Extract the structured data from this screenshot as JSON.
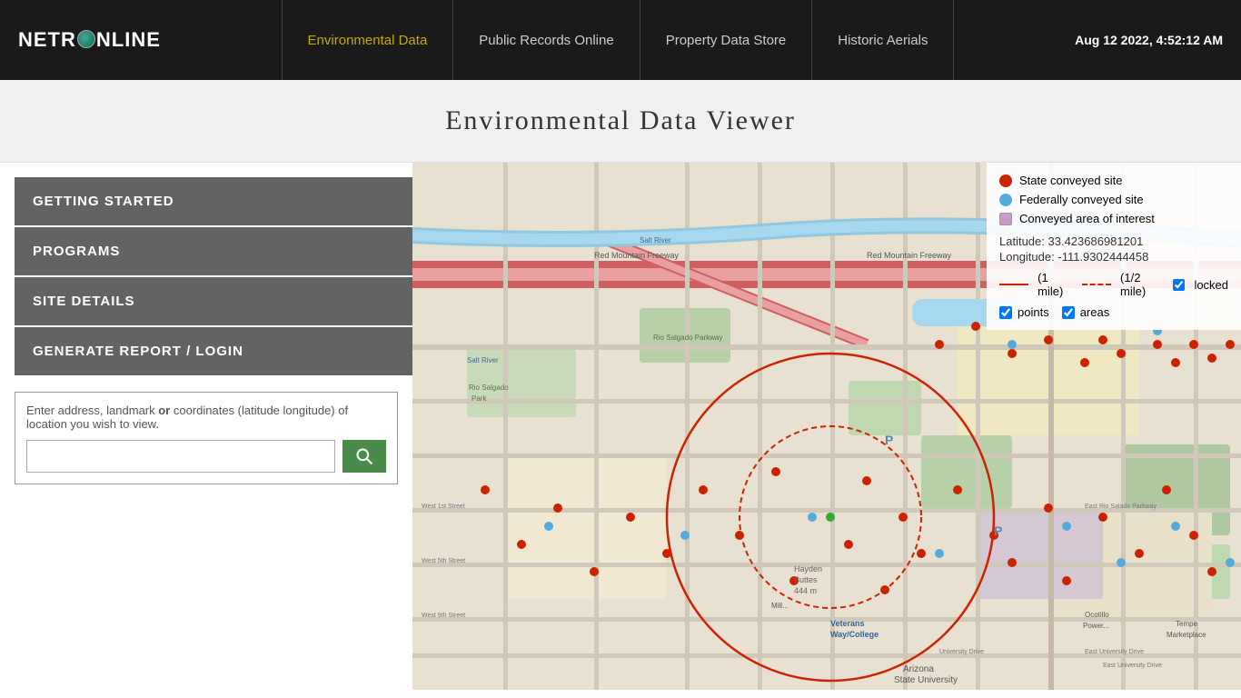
{
  "header": {
    "logo": "NETR●NLINE",
    "logo_text_before": "NETR",
    "logo_text_after": "NLINE",
    "datetime": "Aug 12 2022, 4:52:12 AM",
    "nav": [
      {
        "id": "env",
        "label": "Environmental Data",
        "active": true
      },
      {
        "id": "pub",
        "label": "Public Records Online",
        "active": false
      },
      {
        "id": "prop",
        "label": "Property Data Store",
        "active": false
      },
      {
        "id": "hist",
        "label": "Historic Aerials",
        "active": false
      }
    ]
  },
  "page_title": "Environmental Data Viewer",
  "sidebar": {
    "buttons": [
      {
        "id": "getting-started",
        "label": "GETTING STARTED"
      },
      {
        "id": "programs",
        "label": "PROGRAMS"
      },
      {
        "id": "site-details",
        "label": "SITE DETAILS"
      },
      {
        "id": "generate-report",
        "label": "GENERATE REPORT / LOGIN"
      }
    ]
  },
  "search": {
    "placeholder": "Enter address, landmark or coordinates (latitude longitude) of location you wish to view.",
    "placeholder_bold": "or",
    "button_icon": "search"
  },
  "legend": {
    "items": [
      {
        "id": "state-conveyed",
        "color": "red",
        "label": "State conveyed site"
      },
      {
        "id": "federally-conveyed",
        "color": "blue",
        "label": "Federally conveyed site"
      },
      {
        "id": "conveyed-area",
        "color": "lavender",
        "label": "Conveyed area of interest"
      }
    ],
    "latitude_label": "Latitude:",
    "latitude_value": "33.423686981201",
    "longitude_label": "Longitude:",
    "longitude_value": "-111.9302444458",
    "radius_1mile": "(1 mile)",
    "radius_half_mile": "(1/2 mile)",
    "locked_label": "locked",
    "points_label": "points",
    "areas_label": "areas"
  }
}
